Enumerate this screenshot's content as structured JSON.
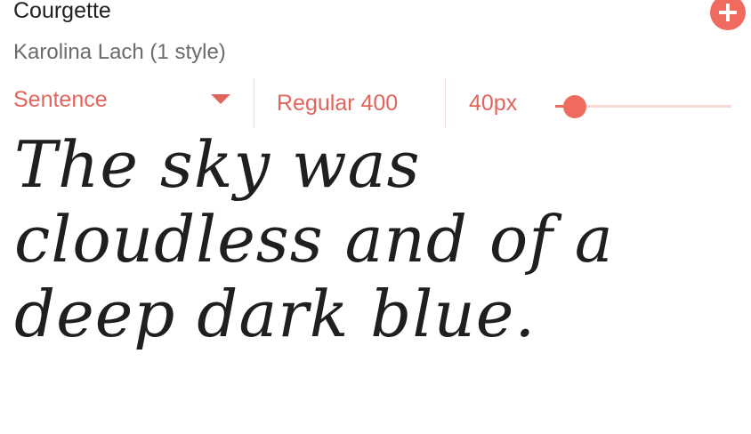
{
  "font": {
    "name": "Courgette",
    "designer": "Karolina Lach (1 style)"
  },
  "icons": {
    "add": "plus-icon",
    "dropdown": "caret-down-icon"
  },
  "controls": {
    "preview_mode": "Sentence",
    "weight": "Regular 400",
    "size_label": "40px",
    "size_slider_fraction": 0.11
  },
  "preview_text": "The sky was cloudless and of a deep dark blue.",
  "colors": {
    "accent": "#ef6a5f",
    "accent_text": "#e0655c",
    "track": "#f9d7d3",
    "text": "#1f1f1f"
  }
}
